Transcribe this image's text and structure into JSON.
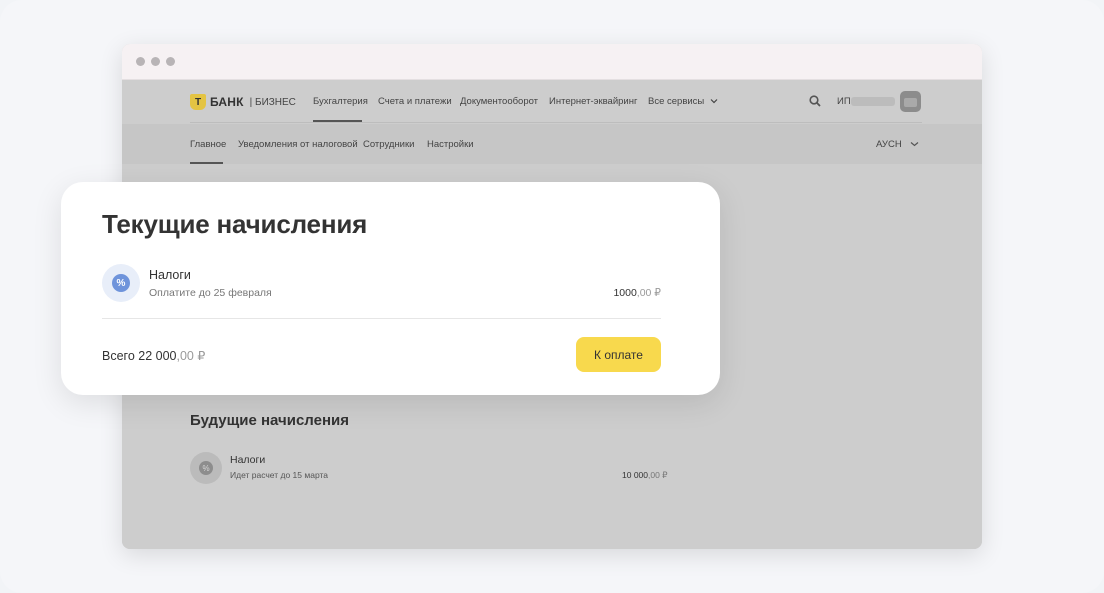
{
  "header": {
    "logo_mark": "Т",
    "logo_name": "БАНК",
    "logo_sub": "| БИЗНЕС",
    "nav": [
      {
        "label": "Бухгалтерия",
        "active": true
      },
      {
        "label": "Счета и платежи",
        "active": false
      },
      {
        "label": "Документооборот",
        "active": false
      },
      {
        "label": "Интернет-эквайринг",
        "active": false
      },
      {
        "label": "Все сервисы",
        "active": false
      }
    ],
    "user_prefix": "ИП"
  },
  "subnav": {
    "items": [
      {
        "label": "Главное",
        "active": true
      },
      {
        "label": "Уведомления от налоговой",
        "active": false
      },
      {
        "label": "Сотрудники",
        "active": false
      },
      {
        "label": "Настройки",
        "active": false
      }
    ],
    "regime": "АУСН"
  },
  "current": {
    "title": "Текущие начисления",
    "item": {
      "name": "Налоги",
      "subtitle": "Оплатите до 25 февраля",
      "amount_main": "1000",
      "amount_rest": ",00 ₽"
    },
    "total_main": "Всего 22 000",
    "total_rest": ",00 ₽",
    "pay_label": "К оплате"
  },
  "future": {
    "title": "Будущие начисления",
    "item": {
      "name": "Налоги",
      "subtitle": "Идет расчет до 15 марта",
      "amount_main": "10 000",
      "amount_rest": ",00 ₽"
    }
  },
  "colors": {
    "accent": "#f8d94d",
    "tax_icon": "#6f94db",
    "overlay": "#cdcdcd"
  }
}
